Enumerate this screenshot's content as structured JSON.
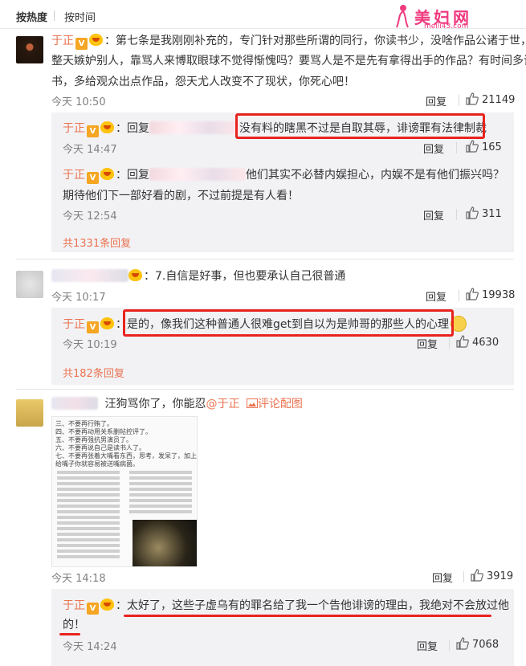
{
  "tabs": {
    "hot": "按热度",
    "time": "按时间"
  },
  "watermark": {
    "main": "美妇网",
    "sub": "meili43.com"
  },
  "c1": {
    "name": "于正",
    "line1": "：第七条是我刚刚补充的，专门针对那些所谓的同行，你读书少，没啥作品公诸于世，",
    "line2": "整天嫉妒别人，靠骂人来博取眼球不觉得惭愧吗？要骂人是不是先有拿得出手的作品？有时间多读",
    "line3": "书，多给观众出点作品，怨天尤人改变不了现状，你死心吧！",
    "time": "今天 10:50",
    "reply": "回复",
    "likes": "21149"
  },
  "r1": {
    "name": "于正",
    "prefix": "：回复",
    "text": "没有料的瞎黑不过是自取其辱，诽谤罪有法律制裁",
    "time": "今天 14:47",
    "reply": "回复",
    "likes": "165"
  },
  "r2": {
    "name": "于正",
    "prefix": "：回复",
    "text1": "他们其实不必替内娱担心，内娱不是有他们振兴吗？",
    "text2": "期待他们下一部好看的剧，不过前提是有人看！",
    "time": "今天 12:54",
    "reply": "回复",
    "likes": "311"
  },
  "more1": "共1331条回复",
  "c2": {
    "text": "：7.自信是好事，但也要承认自己很普通",
    "time": "今天 10:17",
    "reply": "回复",
    "likes": "19938"
  },
  "r3": {
    "name": "于正",
    "text": "：是的，像我们这种普通人很难get到自以为是帅哥的那些人的心理",
    "time": "今天 10:19",
    "reply": "回复",
    "likes": "4630"
  },
  "more2": "共182条回复",
  "c3": {
    "text": "汪狗骂你了，你能忍",
    "mention": "@于正",
    "pic": "评论配图",
    "time": "今天 14:18",
    "reply": "回复",
    "likes": "3919",
    "image_lines": [
      "三、不要再行贿了。",
      "四、不要再动用关系删帖控评了。",
      "五、不要再强抗男演员了。",
      "六、不要再说自己是读书人了。",
      "七、不要再张着大嘴看东西，思考，发呆了，加上",
      "给嘴子你就容易被送嘴病菌。"
    ]
  },
  "r4": {
    "name": "于正",
    "line1": "：太好了，这些子虚乌有的罪名给了我一个告他诽谤的理由，我绝对不会放过他",
    "line2": "的！",
    "time": "今天 14:24",
    "reply": "回复",
    "likes": "7068"
  },
  "colors": {
    "name": "#eb7350",
    "annotation": "#e8231e",
    "reply_bg": "#f2f2f5"
  }
}
